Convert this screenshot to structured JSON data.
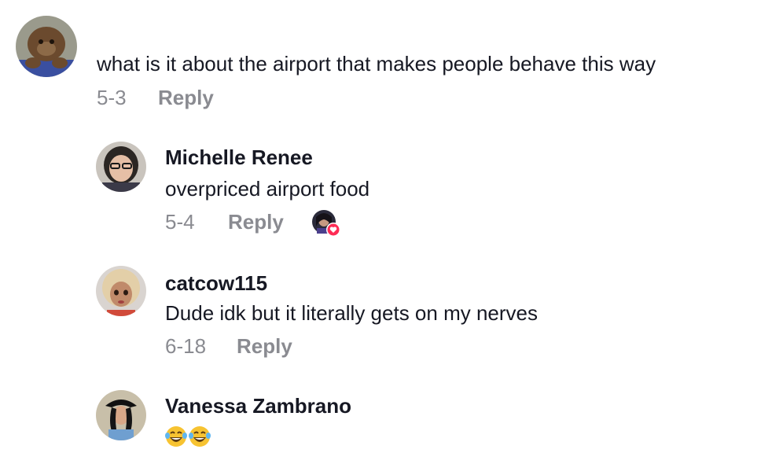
{
  "comments": [
    {
      "avatar_icon": "orangutan-avatar-icon",
      "text": "what is it about the airport that makes people behave this way",
      "date": "5-3",
      "reply_label": "Reply"
    }
  ],
  "replies": [
    {
      "username": "Michelle Renee",
      "avatar_icon": "user-avatar-icon",
      "text": "overpriced airport food",
      "date": "5-4",
      "reply_label": "Reply",
      "liked_by_creator": true,
      "liked_badge_icon": "heart-badge-icon"
    },
    {
      "username": "catcow115",
      "avatar_icon": "doll-avatar-icon",
      "text": "Dude idk but it literally gets on my nerves",
      "date": "6-18",
      "reply_label": "Reply"
    },
    {
      "username": "Vanessa Zambrano",
      "avatar_icon": "user-avatar-icon",
      "emojis": [
        "laughing-tears-emoji",
        "laughing-tears-emoji"
      ]
    }
  ],
  "colors": {
    "text_primary": "#161823",
    "text_secondary": "#8a8b91",
    "heart_badge": "#fe2c55"
  }
}
